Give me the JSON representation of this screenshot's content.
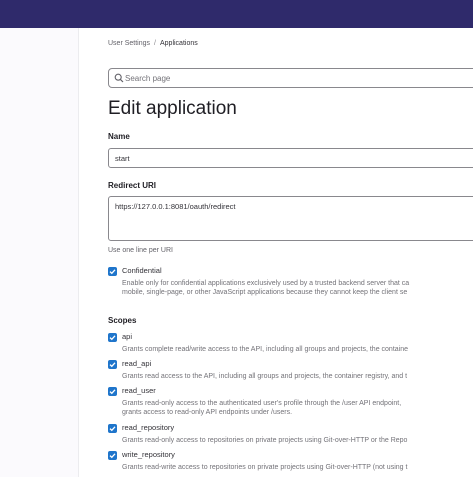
{
  "breadcrumb": {
    "parent": "User Settings",
    "separator": "/",
    "current": "Applications"
  },
  "search": {
    "placeholder": "Search page"
  },
  "page_title": "Edit application",
  "name_field": {
    "label": "Name",
    "value": "start"
  },
  "redirect_field": {
    "label": "Redirect URI",
    "value": "https://127.0.0.1:8081/oauth/redirect",
    "help": "Use one line per URI"
  },
  "confidential": {
    "label": "Confidential",
    "checked": true,
    "description": [
      "Enable only for confidential applications exclusively used by a trusted backend server that ca",
      "mobile, single-page, or other JavaScript applications because they cannot keep the client se"
    ]
  },
  "scopes": {
    "heading": "Scopes",
    "items": [
      {
        "name": "api",
        "checked": true,
        "description": [
          "Grants complete read/write access to the API, including all groups and projects, the containe"
        ]
      },
      {
        "name": "read_api",
        "checked": true,
        "description": [
          "Grants read access to the API, including all groups and projects, the container registry, and t"
        ]
      },
      {
        "name": "read_user",
        "checked": true,
        "description": [
          "Grants read-only access to the authenticated user's profile through the /user API endpoint, ",
          "grants access to read-only API endpoints under /users."
        ]
      },
      {
        "name": "read_repository",
        "checked": true,
        "description": [
          "Grants read-only access to repositories on private projects using Git-over-HTTP or the Repo"
        ]
      },
      {
        "name": "write_repository",
        "checked": true,
        "description": [
          "Grants read-write access to repositories on private projects using Git-over-HTTP (not using t"
        ]
      }
    ]
  },
  "colors": {
    "topbar": "#2f2a6b",
    "checkbox": "#1f75cb"
  }
}
